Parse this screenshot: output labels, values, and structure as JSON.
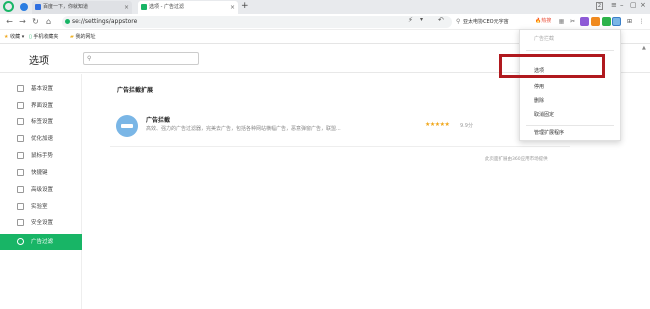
{
  "tabs": [
    {
      "label": "百度一下，你就知道"
    },
    {
      "label": "选项 - 广告过滤"
    }
  ],
  "toolbar": {
    "url": "se://settings/appstore",
    "search_text": "亚太电协CEO元宇宙",
    "hot_label": "热搜",
    "window_count": "2"
  },
  "bookmarks": {
    "collect": "收藏",
    "mobile": "手机收藏夹",
    "mysite": "我的网址"
  },
  "page": {
    "title": "选项"
  },
  "sidebar": {
    "items": [
      {
        "label": "基本设置"
      },
      {
        "label": "界面设置"
      },
      {
        "label": "标签设置"
      },
      {
        "label": "优化加速"
      },
      {
        "label": "鼠标手势"
      },
      {
        "label": "快捷键"
      },
      {
        "label": "高级设置"
      },
      {
        "label": "实验室"
      },
      {
        "label": "安全设置"
      },
      {
        "label": "广告过滤"
      }
    ]
  },
  "main": {
    "section_title": "广告拦截扩展",
    "extension": {
      "name": "广告拦截",
      "description": "高效、强力的广告过滤器，完美去广告，包括各种网站横幅广告，恶意弹窗广告，联盟...",
      "stars": "★★★★★",
      "rating": "9.9分"
    },
    "footnote": "此页面扩展由360应用市场提供"
  },
  "context_menu": {
    "header": "广告拦截",
    "items": [
      {
        "label": "选项"
      },
      {
        "label": "停用"
      },
      {
        "label": "删除"
      },
      {
        "label": "取消固定"
      }
    ],
    "manage": "管理扩展程序"
  },
  "colors": {
    "accent_green": "#18b566",
    "highlight_red": "#b0191e"
  }
}
